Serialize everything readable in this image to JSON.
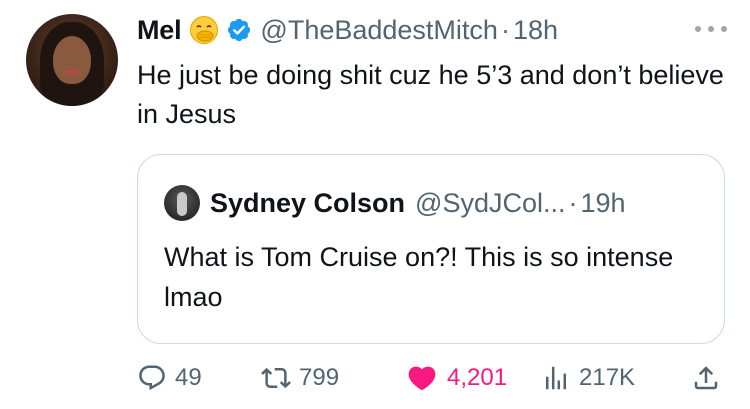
{
  "tweet": {
    "display_name": "Mel",
    "handle": "@TheBaddestMitch",
    "separator": "·",
    "time": "18h",
    "text": "He just be doing shit cuz he 5’3 and don’t believe in Jesus",
    "emoji": "face-with-hand-over-mouth",
    "verified_color": "#1d9bf0"
  },
  "quote": {
    "display_name": "Sydney Colson",
    "handle": "@SydJCol...",
    "separator": "·",
    "time": "19h",
    "text": "What is Tom Cruise on?! This is so intense lmao"
  },
  "actions": {
    "replies": "49",
    "reposts": "799",
    "likes": "4,201",
    "views": "217K"
  },
  "colors": {
    "text": "#0f1419",
    "muted": "#536471",
    "like": "#f91880",
    "border": "#cfd9de"
  }
}
